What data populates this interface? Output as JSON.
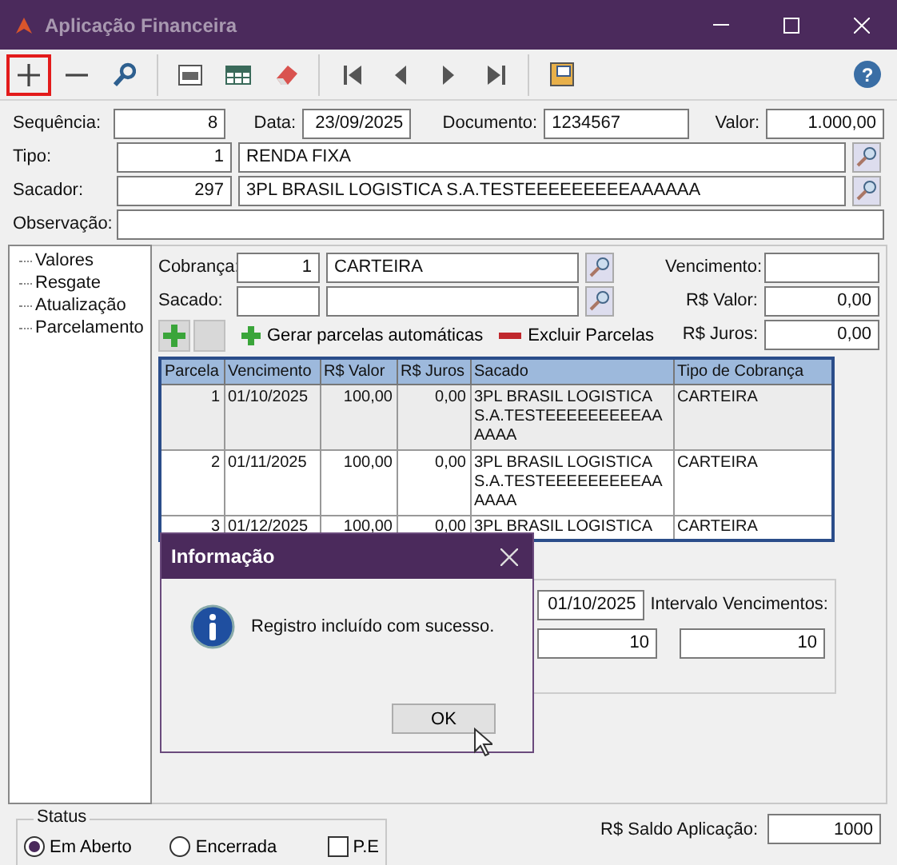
{
  "window": {
    "title": "Aplicação Financeira"
  },
  "toolbar": [
    [
      {
        "kind": "plus",
        "highlighted": true
      },
      {
        "kind": "minus",
        "highlighted": false
      },
      {
        "kind": "search",
        "highlighted": false
      }
    ],
    [
      {
        "kind": "txt",
        "highlighted": false
      },
      {
        "kind": "grid",
        "highlighted": false
      },
      {
        "kind": "eraser",
        "highlighted": false
      }
    ],
    [
      {
        "kind": "first",
        "highlighted": false
      },
      {
        "kind": "prev",
        "highlighted": false
      },
      {
        "kind": "next",
        "highlighted": false
      },
      {
        "kind": "last",
        "highlighted": false
      }
    ],
    [
      {
        "kind": "log",
        "highlighted": false
      }
    ]
  ],
  "help": {
    "glyph": "?"
  },
  "header": {
    "sequencia": {
      "label": "Sequência:",
      "value": "8"
    },
    "data": {
      "label": "Data:",
      "value": "23/09/2025"
    },
    "documento": {
      "label": "Documento:",
      "value": "1234567"
    },
    "valor": {
      "label": "Valor:",
      "value": "1.000,00"
    },
    "tipo": {
      "label": "Tipo:",
      "code": "1",
      "name": "RENDA FIXA"
    },
    "sacador": {
      "label": "Sacador:",
      "code": "297",
      "name": "3PL BRASIL LOGISTICA S.A.TESTEEEEEEEEEAAAAAA"
    },
    "observacao": {
      "label": "Observação:"
    }
  },
  "tree": [
    {
      "label": "Valores"
    },
    {
      "label": "Resgate"
    },
    {
      "label": "Atualização"
    },
    {
      "label": "Parcelamento"
    }
  ],
  "cobranca": {
    "label": "Cobrança:",
    "code": "1",
    "name": "CARTEIRA"
  },
  "sacado": {
    "label": "Sacado:"
  },
  "vencimento": {
    "label": "Vencimento:"
  },
  "rs_valor": {
    "label": "R$ Valor:",
    "value": "0,00"
  },
  "rs_juros": {
    "label": "R$ Juros:",
    "value": "0,00"
  },
  "actions": [
    {
      "kind": "add",
      "label": "Gerar parcelas automáticas"
    },
    {
      "kind": "remove",
      "label": "Excluir Parcelas"
    }
  ],
  "table": {
    "columns": [
      "Parcela",
      "Vencimento",
      "R$ Valor",
      "R$ Juros",
      "Sacado",
      "Tipo de Cobrança"
    ],
    "rows": [
      {
        "selected": true,
        "cells": [
          "1",
          "01/10/2025",
          "100,00",
          "0,00",
          "3PL BRASIL LOGISTICA S.A.TESTEEEEEEEEEAAAAAA",
          "CARTEIRA"
        ]
      },
      {
        "selected": false,
        "cells": [
          "2",
          "01/11/2025",
          "100,00",
          "0,00",
          "3PL BRASIL LOGISTICA S.A.TESTEEEEEEEEEAAAAAA",
          "CARTEIRA"
        ]
      },
      {
        "selected": false,
        "cells": [
          "3",
          "01/12/2025",
          "100,00",
          "0,00",
          "3PL BRASIL LOGISTICA",
          "CARTEIRA"
        ]
      }
    ]
  },
  "generator": {
    "date": "01/10/2025",
    "interval_label": "Intervalo Vencimentos:",
    "count": "10",
    "interval": "10"
  },
  "dialog": {
    "title": "Informação",
    "message": "Registro incluído com sucesso.",
    "button": "OK"
  },
  "status": {
    "label": "Status",
    "options": [
      {
        "label": "Em Aberto",
        "selected": true
      },
      {
        "label": "Encerrada",
        "selected": false
      }
    ],
    "pe": {
      "label": "P.E",
      "checked": false
    }
  },
  "saldo": {
    "label": "R$ Saldo Aplicação:",
    "value": "1000"
  }
}
